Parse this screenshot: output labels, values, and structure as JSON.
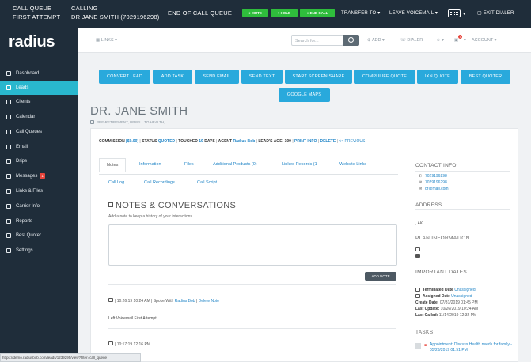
{
  "topbar": {
    "call_queue_label": "CALL QUEUE",
    "call_queue_status": "FIRST ATTEMPT",
    "calling_label": "CALLING",
    "calling_value": "DR JANE SMITH (7029196298)",
    "end_queue": "END OF CALL QUEUE",
    "mute": "MUTE",
    "hold": "HOLD",
    "end_call": "END CALL",
    "transfer": "TRANSFER TO",
    "leave_voicemail": "LEAVE VOICEMAIL",
    "exit_dialer": "EXIT DIALER"
  },
  "sidebar": {
    "logo": "radius",
    "items": [
      {
        "label": "Dashboard",
        "icon": "dashboard-icon"
      },
      {
        "label": "Leads",
        "icon": "leads-icon",
        "active": true
      },
      {
        "label": "Clients",
        "icon": "clients-icon"
      },
      {
        "label": "Calendar",
        "icon": "calendar-icon"
      },
      {
        "label": "Call Queues",
        "icon": "phone-icon"
      },
      {
        "label": "Email",
        "icon": "email-icon"
      },
      {
        "label": "Drips",
        "icon": "drips-icon"
      },
      {
        "label": "Messages",
        "icon": "messages-icon",
        "badge": "1"
      },
      {
        "label": "Links & Files",
        "icon": "link-icon"
      },
      {
        "label": "Carrier Info",
        "icon": "info-icon"
      },
      {
        "label": "Reports",
        "icon": "reports-icon"
      },
      {
        "label": "Best Quoter",
        "icon": "quoter-icon"
      },
      {
        "label": "Settings",
        "icon": "gear-icon"
      }
    ]
  },
  "header": {
    "links": "LINKS",
    "search_placeholder": "Search for...",
    "add": "ADD",
    "dialer": "DIALER",
    "notification_count": "5",
    "account": "ACCOUNT"
  },
  "actions": {
    "convert_lead": "CONVERT LEAD",
    "add_task": "ADD TASK",
    "send_email": "SEND EMAIL",
    "send_text": "SEND TEXT",
    "screen_share": "START SCREEN SHARE",
    "compulife": "COMPULIFE QUOTE",
    "ixn_quote": "IXN QUOTE",
    "best_quoter": "BEST QUOTER",
    "google_maps": "GOOGLE MAPS"
  },
  "contact": {
    "name": "DR. JANE SMITH",
    "tags": "PRE-RETIREMENT, UPSELL TO HEALTH,"
  },
  "infobar": {
    "commission_label": "COMMISSION",
    "commission_value": "[$0.00]",
    "status_label": "STATUS",
    "status_value": "QUOTED",
    "touched_label": "TOUCHED",
    "touched_value": "19",
    "days": "DAYS",
    "agent_label": "AGENT",
    "agent_value": "Radius Bob",
    "age_label": "LEAD'S AGE: 100",
    "print": "PRINT INFO",
    "delete": "DELETE",
    "previous": "<< PREVIOUS"
  },
  "tabs": {
    "notes": "Notes",
    "information": "Information",
    "files": "Files",
    "additional_products": "Additional Products (0)",
    "linked_records": "Linked Records (1",
    "website_links": "Website Links",
    "call_log": "Call Log",
    "call_recordings": "Call Recordings",
    "call_script": "Call Script"
  },
  "notes": {
    "title": "NOTES & CONVERSATIONS",
    "hint": "Add a note to keep a history of your interactions.",
    "add_button": "ADD NOTE",
    "entries": [
      {
        "time": "| 10:26:19 10:24 AM |",
        "spoke": "Spoke With",
        "agent": "Radius Bob",
        "delete": "Delete Note",
        "body": "Left Voicemail First Attempt"
      },
      {
        "time": "| 10:17:19 12:16 PM",
        "spoke": "",
        "agent": "",
        "delete": "",
        "body": ""
      }
    ]
  },
  "right": {
    "contact_info": "CONTACT INFO",
    "phone1": "7029196298",
    "phone2": "7029196298",
    "email": "dr@mail.com",
    "address": "ADDRESS",
    "address_value": ", AK",
    "plan_info": "PLAN INFORMATION",
    "important_dates": "IMPORTANT DATES",
    "terminated_label": "Terminated Date",
    "terminated_value": "Unassigned",
    "assigned_label": "Assigned Date",
    "assigned_value": "Unassigned",
    "create_label": "Create Date:",
    "create_value": "07/31/2019 01:45 PM",
    "last_update_label": "Last Update:",
    "last_update_value": "10/26/2019 10:24 AM",
    "last_called_label": "Last Called:",
    "last_called_value": "11/14/2019 12:32 PM",
    "tasks": "TASKS",
    "task_text": "Appointment: Discuss Health needs for family - 05/23/2019 01:51 PM"
  },
  "statusbar": "https://demo.radiusbob.com/leads/1239295/view?filter=call_queue"
}
